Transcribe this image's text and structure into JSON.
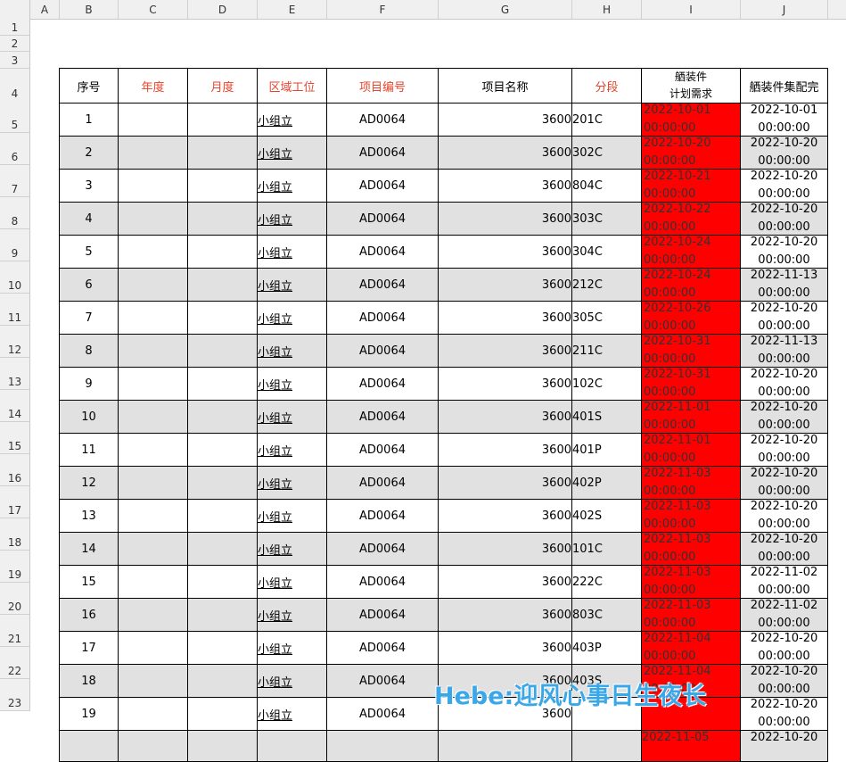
{
  "columns": [
    "A",
    "B",
    "C",
    "D",
    "E",
    "F",
    "G",
    "H",
    "I",
    "J"
  ],
  "row_numbers": [
    "1",
    "2",
    "3",
    "4",
    "5",
    "6",
    "7",
    "8",
    "9",
    "10",
    "11",
    "12",
    "13",
    "14",
    "15",
    "16",
    "17",
    "18",
    "19",
    "20",
    "21",
    "22",
    "23"
  ],
  "headers": {
    "seq": "序号",
    "year": "年度",
    "month": "月度",
    "area": "区域工位",
    "project_code": "项目编号",
    "project_name": "项目名称",
    "segment": "分段",
    "plan_line1": "舾装件",
    "plan_line2": "计划需求",
    "done": "舾装件集配完"
  },
  "rows": [
    {
      "seq": "1",
      "area": "小组立",
      "code": "AD0064",
      "name": "3600",
      "seg": "201C",
      "plan_date": "2022-10-01",
      "plan_time": "00:00:00",
      "done_date": "2022-10-01",
      "done_time": "00:00:00"
    },
    {
      "seq": "2",
      "area": "小组立",
      "code": "AD0064",
      "name": "3600",
      "seg": "302C",
      "plan_date": "2022-10-20",
      "plan_time": "00:00:00",
      "done_date": "2022-10-20",
      "done_time": "00:00:00"
    },
    {
      "seq": "3",
      "area": "小组立",
      "code": "AD0064",
      "name": "3600",
      "seg": "804C",
      "plan_date": "2022-10-21",
      "plan_time": "00:00:00",
      "done_date": "2022-10-20",
      "done_time": "00:00:00"
    },
    {
      "seq": "4",
      "area": "小组立",
      "code": "AD0064",
      "name": "3600",
      "seg": "303C",
      "plan_date": "2022-10-22",
      "plan_time": "00:00:00",
      "done_date": "2022-10-20",
      "done_time": "00:00:00"
    },
    {
      "seq": "5",
      "area": "小组立",
      "code": "AD0064",
      "name": "3600",
      "seg": "304C",
      "plan_date": "2022-10-24",
      "plan_time": "00:00:00",
      "done_date": "2022-10-20",
      "done_time": "00:00:00"
    },
    {
      "seq": "6",
      "area": "小组立",
      "code": "AD0064",
      "name": "3600",
      "seg": "212C",
      "plan_date": "2022-10-24",
      "plan_time": "00:00:00",
      "done_date": "2022-11-13",
      "done_time": "00:00:00"
    },
    {
      "seq": "7",
      "area": "小组立",
      "code": "AD0064",
      "name": "3600",
      "seg": "305C",
      "plan_date": "2022-10-26",
      "plan_time": "00:00:00",
      "done_date": "2022-10-20",
      "done_time": "00:00:00"
    },
    {
      "seq": "8",
      "area": "小组立",
      "code": "AD0064",
      "name": "3600",
      "seg": "211C",
      "plan_date": "2022-10-31",
      "plan_time": "00:00:00",
      "done_date": "2022-11-13",
      "done_time": "00:00:00"
    },
    {
      "seq": "9",
      "area": "小组立",
      "code": "AD0064",
      "name": "3600",
      "seg": "102C",
      "plan_date": "2022-10-31",
      "plan_time": "00:00:00",
      "done_date": "2022-10-20",
      "done_time": "00:00:00"
    },
    {
      "seq": "10",
      "area": "小组立",
      "code": "AD0064",
      "name": "3600",
      "seg": "401S",
      "plan_date": "2022-11-01",
      "plan_time": "00:00:00",
      "done_date": "2022-10-20",
      "done_time": "00:00:00"
    },
    {
      "seq": "11",
      "area": "小组立",
      "code": "AD0064",
      "name": "3600",
      "seg": "401P",
      "plan_date": "2022-11-01",
      "plan_time": "00:00:00",
      "done_date": "2022-10-20",
      "done_time": "00:00:00"
    },
    {
      "seq": "12",
      "area": "小组立",
      "code": "AD0064",
      "name": "3600",
      "seg": "402P",
      "plan_date": "2022-11-03",
      "plan_time": "00:00:00",
      "done_date": "2022-10-20",
      "done_time": "00:00:00"
    },
    {
      "seq": "13",
      "area": "小组立",
      "code": "AD0064",
      "name": "3600",
      "seg": "402S",
      "plan_date": "2022-11-03",
      "plan_time": "00:00:00",
      "done_date": "2022-10-20",
      "done_time": "00:00:00"
    },
    {
      "seq": "14",
      "area": "小组立",
      "code": "AD0064",
      "name": "3600",
      "seg": "101C",
      "plan_date": "2022-11-03",
      "plan_time": "00:00:00",
      "done_date": "2022-10-20",
      "done_time": "00:00:00"
    },
    {
      "seq": "15",
      "area": "小组立",
      "code": "AD0064",
      "name": "3600",
      "seg": "222C",
      "plan_date": "2022-11-03",
      "plan_time": "00:00:00",
      "done_date": "2022-11-02",
      "done_time": "00:00:00"
    },
    {
      "seq": "16",
      "area": "小组立",
      "code": "AD0064",
      "name": "3600",
      "seg": "803C",
      "plan_date": "2022-11-03",
      "plan_time": "00:00:00",
      "done_date": "2022-11-02",
      "done_time": "00:00:00"
    },
    {
      "seq": "17",
      "area": "小组立",
      "code": "AD0064",
      "name": "3600",
      "seg": "403P",
      "plan_date": "2022-11-04",
      "plan_time": "00:00:00",
      "done_date": "2022-10-20",
      "done_time": "00:00:00"
    },
    {
      "seq": "18",
      "area": "小组立",
      "code": "AD0064",
      "name": "3600",
      "seg": "403S",
      "plan_date": "2022-11-04",
      "plan_time": "00:00:00",
      "done_date": "2022-10-20",
      "done_time": "00:00:00"
    },
    {
      "seq": "19",
      "area": "小组立",
      "code": "AD0064",
      "name": "3600",
      "seg": "",
      "plan_date": "",
      "plan_time": "",
      "done_date": "2022-10-20",
      "done_time": "00:00:00"
    }
  ],
  "partial_row": {
    "plan_date": "2022-11-05",
    "done_date": "2022-10-20"
  },
  "colors": {
    "plan_fill": "#ff0000",
    "header_red": "#e8432b",
    "alt_row": "#e1e1e1"
  },
  "watermark": "Hebe:迎风心事日生夜长"
}
